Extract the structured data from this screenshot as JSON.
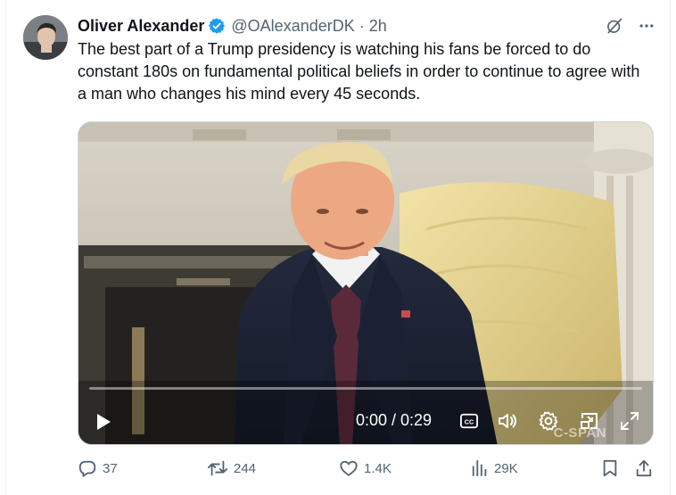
{
  "author": {
    "display_name": "Oliver Alexander",
    "handle": "@OAlexanderDK",
    "separator": "·",
    "time": "2h"
  },
  "tweet": {
    "text": "The best part of a Trump presidency is watching his fans be forced to do constant 180s on fundamental political beliefs in order to continue to agree with a man who changes his mind every 45 seconds."
  },
  "video": {
    "timecode": "0:00 / 0:29",
    "watermark": "C-SPAN",
    "progress": 0.0,
    "icons": [
      "play-icon",
      "captions-icon",
      "volume-icon",
      "settings-icon",
      "dock-icon",
      "fullscreen-icon"
    ]
  },
  "engagement": {
    "replies": "37",
    "reposts": "244",
    "likes": "1.4K",
    "views": "29K"
  },
  "colors": {
    "text_primary": "#0f1419",
    "text_secondary": "#536471",
    "verified_blue": "#1d9bf0",
    "border": "#cfd9de"
  }
}
